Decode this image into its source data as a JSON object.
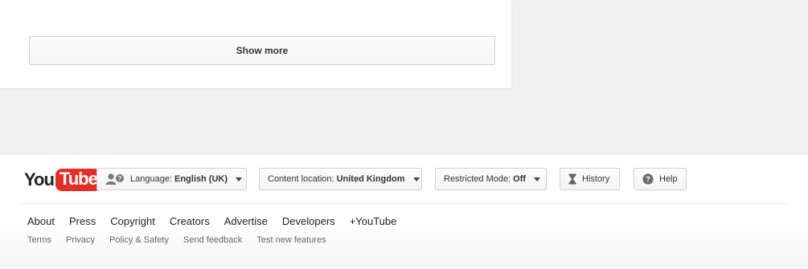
{
  "main": {
    "show_more_label": "Show more"
  },
  "footer": {
    "logo": {
      "you": "You",
      "tube": "Tube",
      "brand_color": "#e52d27"
    },
    "language": {
      "prefix": "Language:",
      "value": "English (UK)",
      "icon": "user-question-icon"
    },
    "content_location": {
      "prefix": "Content location:",
      "value": "United Kingdom"
    },
    "restricted_mode": {
      "prefix": "Restricted Mode:",
      "value": "Off"
    },
    "history": {
      "label": "History",
      "icon": "hourglass-icon"
    },
    "help": {
      "label": "Help",
      "icon": "help-icon"
    },
    "primary_links": [
      "About",
      "Press",
      "Copyright",
      "Creators",
      "Advertise",
      "Developers",
      "+YouTube"
    ],
    "secondary_links": [
      "Terms",
      "Privacy",
      "Policy & Safety",
      "Send feedback",
      "Test new features"
    ]
  }
}
